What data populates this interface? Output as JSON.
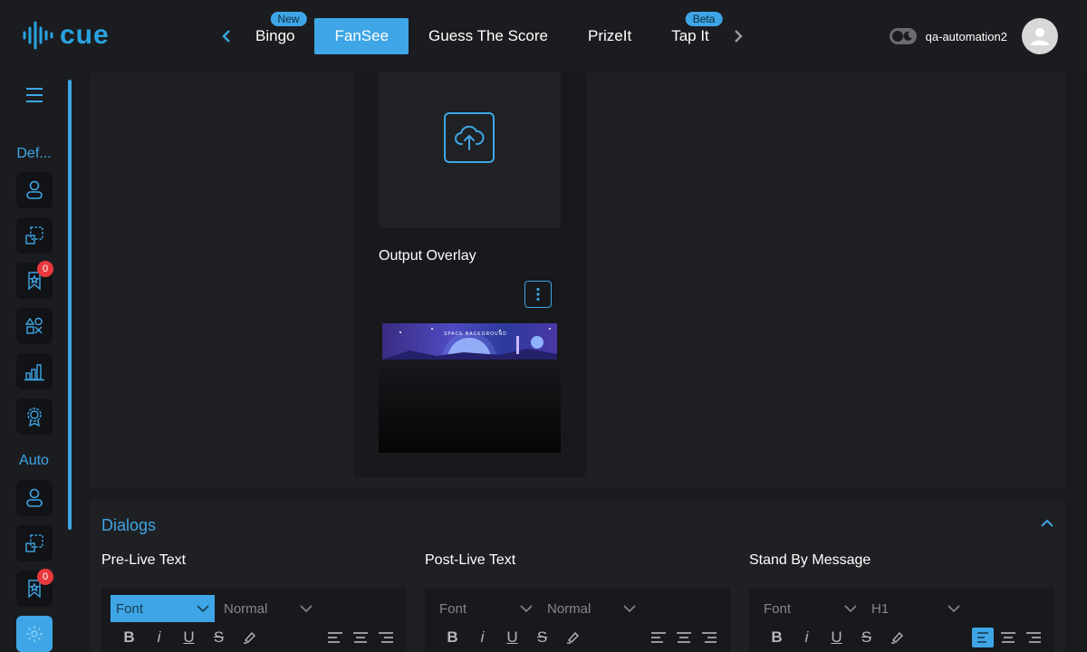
{
  "brand": {
    "name": "cue",
    "accent": "#3ea6e6"
  },
  "nav": {
    "items": [
      {
        "label": "Bingo",
        "badge": "New",
        "active": false
      },
      {
        "label": "FanSee",
        "badge": "",
        "active": true
      },
      {
        "label": "Guess The Score",
        "badge": "",
        "active": false
      },
      {
        "label": "PrizeIt",
        "badge": "",
        "active": false
      },
      {
        "label": "Tap It",
        "badge": "Beta",
        "active": false
      }
    ],
    "prev_icon": "chevron-left-icon",
    "next_icon": "chevron-right-icon"
  },
  "user": {
    "name": "qa-automation2",
    "theme_toggle_icon": "moon-icon",
    "avatar_icon": "user-icon"
  },
  "sidebar": {
    "menu_icon": "hamburger-icon",
    "groups": [
      {
        "label": "Def...",
        "items": [
          {
            "icon": "user-icon",
            "count": ""
          },
          {
            "icon": "select-icon",
            "count": ""
          },
          {
            "icon": "bookmark-star-icon",
            "count": "0"
          },
          {
            "icon": "shapes-icon",
            "count": ""
          },
          {
            "icon": "bar-chart-icon",
            "count": ""
          },
          {
            "icon": "award-icon",
            "count": ""
          }
        ]
      },
      {
        "label": "Auto",
        "items": [
          {
            "icon": "user-icon",
            "count": ""
          },
          {
            "icon": "select-icon",
            "count": ""
          },
          {
            "icon": "bookmark-star-icon",
            "count": "0"
          },
          {
            "icon": "settings-icon",
            "count": ""
          }
        ]
      }
    ]
  },
  "preview": {
    "upload_icon": "cloud-upload-icon",
    "overlay_title": "Output Overlay",
    "overlay_menu_icon": "more-vertical-icon",
    "banner_caption": "SPACE BACKGROUND"
  },
  "dialogs": {
    "title": "Dialogs",
    "collapse_icon": "chevron-up-icon",
    "columns": [
      {
        "title": "Pre-Live Text",
        "font": "Font",
        "size": "Normal",
        "font_active": true,
        "align_active": ""
      },
      {
        "title": "Post-Live Text",
        "font": "Font",
        "size": "Normal",
        "font_active": false,
        "align_active": ""
      },
      {
        "title": "Stand By Message",
        "font": "Font",
        "size": "H1",
        "font_active": false,
        "align_active": "left"
      }
    ],
    "format_buttons": [
      "B",
      "I",
      "U",
      "S"
    ]
  }
}
